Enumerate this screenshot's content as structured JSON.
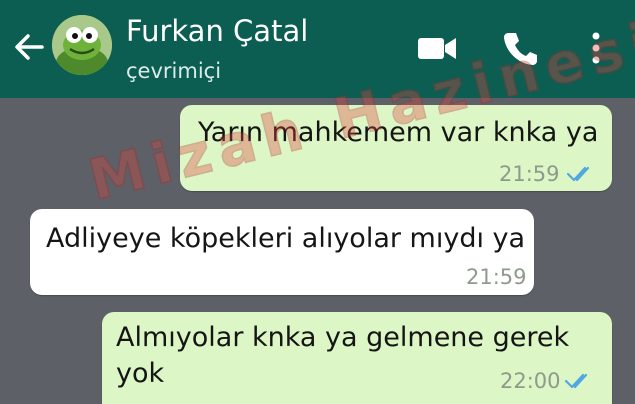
{
  "header": {
    "contact_name": "Furkan Çatal",
    "status": "çevrimiçi",
    "colors": {
      "bar": "#0c5d52",
      "icon": "#ffffff"
    },
    "icons": [
      "back-arrow-icon",
      "avatar",
      "video-call-icon",
      "phone-call-icon",
      "more-options-icon"
    ]
  },
  "messages": [
    {
      "direction": "out",
      "text": "Yarın mahkemem var knka ya",
      "time": "21:59",
      "status": "read"
    },
    {
      "direction": "in",
      "text": "Adliyeye köpekleri alıyolar mıydı ya",
      "time": "21:59"
    },
    {
      "direction": "out",
      "text_line1": "Almıyolar knka ya gelmene gerek",
      "text_line2": "yok",
      "time": "22:00",
      "status": "read"
    }
  ],
  "watermark": {
    "text": "Mizah Hazinesi",
    "color": "#e0443f"
  },
  "colors": {
    "chat_background": "#5d6066",
    "outgoing_bubble": "#dcf6c6",
    "incoming_bubble": "#ffffff",
    "read_tick": "#4fa8e0"
  }
}
